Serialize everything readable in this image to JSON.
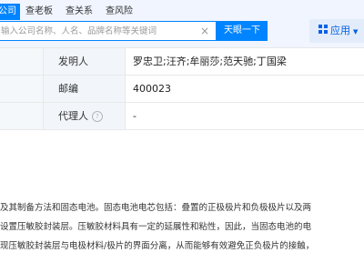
{
  "nav": {
    "tabs": [
      {
        "label": "公司",
        "active": true
      },
      {
        "label": "查老板",
        "active": false
      },
      {
        "label": "查关系",
        "active": false
      },
      {
        "label": "查风险",
        "active": false
      }
    ]
  },
  "search": {
    "placeholder": "输入公司名称、人名、品牌名称等关键词",
    "clear_icon": "×",
    "button_label": "天眼一下"
  },
  "app_menu": {
    "label": "应用",
    "icon": "grid-icon"
  },
  "details": [
    {
      "label": "发明人",
      "value": "罗忠卫;汪齐;牟丽莎;范天驰;丁国梁"
    },
    {
      "label": "邮编",
      "value": "400023"
    },
    {
      "label": "代理人",
      "value": "-",
      "help_icon": "?"
    }
  ],
  "abstract": {
    "lines": [
      "及其制备方法和固态电池。固态电池电芯包括：叠置的正极极片和负极极片以及两",
      "设置压敏胶封装层。压敏胶材料具有一定的延展性和粘性，因此，当固态电池的电",
      "现压敏胶封装层与电极材料/极片的界面分离，从而能够有效避免正负极片的接触，"
    ]
  },
  "colors": {
    "accent": "#0084ff",
    "header_bg": "#f0f5ff",
    "label_bg": "#f2f6fb"
  }
}
